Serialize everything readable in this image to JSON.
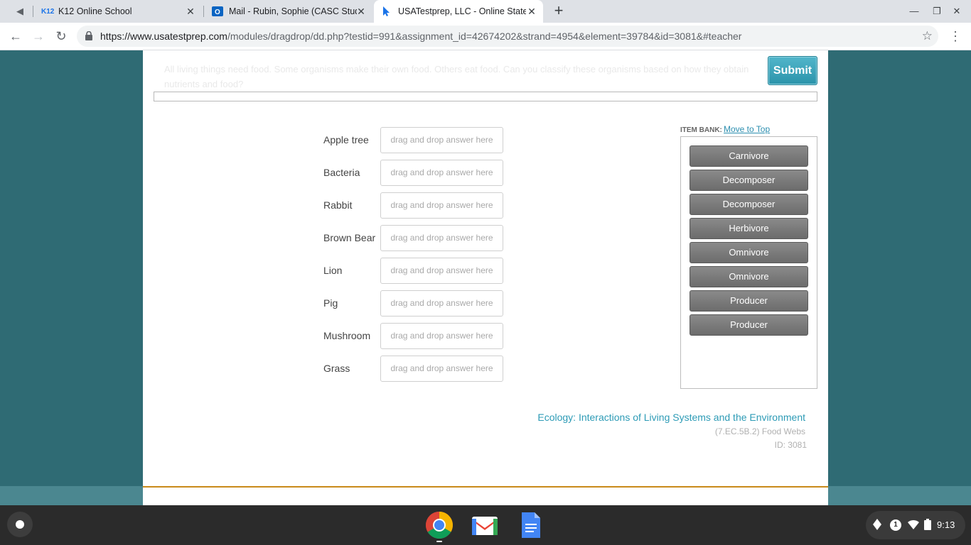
{
  "browser": {
    "tabs": [
      {
        "title": "K12 Online School",
        "favicon": "K12"
      },
      {
        "title": "Mail - Rubin, Sophie (CASC Stude",
        "favicon": "outlook-icon"
      },
      {
        "title": "USATestprep, LLC - Online State-S",
        "favicon": "cursor-icon"
      }
    ],
    "url_host": "https://www.usatestprep.com",
    "url_path": "/modules/dragdrop/dd.php?testid=991&assignment_id=42674202&strand=4954&element=39784&id=3081&#teacher"
  },
  "question": {
    "text": "All living things need food. Some organisms make their own food. Others eat food. Can you classify these organisms based on how they obtain nutrients and food?",
    "submit_label": "Submit"
  },
  "organisms": [
    {
      "label": "Apple tree",
      "placeholder": "drag and drop answer here"
    },
    {
      "label": "Bacteria",
      "placeholder": "drag and drop answer here"
    },
    {
      "label": "Rabbit",
      "placeholder": "drag and drop answer here"
    },
    {
      "label": "Brown Bear",
      "placeholder": "drag and drop answer here"
    },
    {
      "label": "Lion",
      "placeholder": "drag and drop answer here"
    },
    {
      "label": "Pig",
      "placeholder": "drag and drop answer here"
    },
    {
      "label": "Mushroom",
      "placeholder": "drag and drop answer here"
    },
    {
      "label": "Grass",
      "placeholder": "drag and drop answer here"
    }
  ],
  "item_bank": {
    "label": "ITEM BANK:",
    "move_link": "Move to Top",
    "items": [
      "Carnivore",
      "Decomposer",
      "Decomposer",
      "Herbivore",
      "Omnivore",
      "Omnivore",
      "Producer",
      "Producer"
    ]
  },
  "standard": {
    "title": "Ecology: Interactions of Living Systems and the Environment",
    "code": "(7.EC.5B.2) Food Webs",
    "id": "ID: 3081"
  },
  "shelf": {
    "time": "9:13",
    "notification_count": "1"
  },
  "colors": {
    "page_background": "#2f6b74",
    "submit_button": "#2b93aa",
    "link": "#2d9bb6",
    "item_chip": "#7a7a7a",
    "footer_rule": "#c98a1a"
  }
}
